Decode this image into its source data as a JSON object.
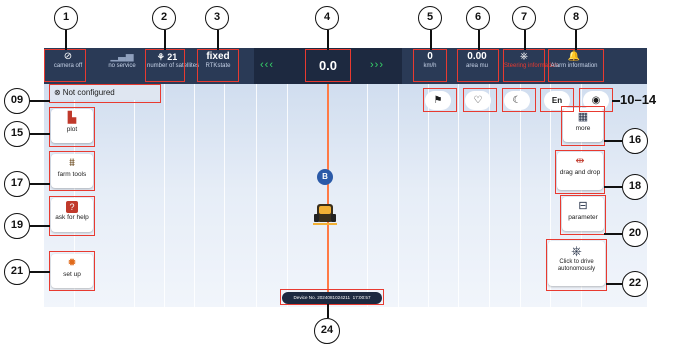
{
  "topbar": {
    "camera": {
      "icon": "camera-off-icon",
      "label": "camera off"
    },
    "network": {
      "icon": "signal-icon",
      "label": "no service"
    },
    "satellites": {
      "icon": "satellite-icon",
      "count": "21",
      "label": "number of satellites"
    },
    "rtk": {
      "status": "fixed",
      "label": "RTKstate"
    },
    "offset": {
      "value": "0.0",
      "left_arrows": "‹‹‹",
      "right_arrows": "›››"
    },
    "speed": {
      "value": "0",
      "unit": "km/h"
    },
    "area": {
      "value": "0.00",
      "label": "area mu"
    },
    "steering": {
      "icon": "steering-wheel-icon",
      "text": "Steering information"
    },
    "alarm": {
      "icon": "bell-icon",
      "label": "Alarm information"
    }
  },
  "status": {
    "not_configured": "Not configured"
  },
  "top_icons": [
    {
      "name": "flag-icon",
      "glyph": "⚑"
    },
    {
      "name": "heart-icon",
      "glyph": "♡"
    },
    {
      "name": "night-mode-icon",
      "glyph": "☾"
    },
    {
      "name": "language-icon",
      "glyph": "En"
    },
    {
      "name": "eye-icon",
      "glyph": "◉"
    }
  ],
  "left_buttons": [
    {
      "label": "plot",
      "icon": "plot-icon"
    },
    {
      "label": "farm tools",
      "icon": "farm-tools-icon"
    },
    {
      "label": "ask for help",
      "icon": "help-icon"
    },
    {
      "label": "set up",
      "icon": "settings-icon"
    }
  ],
  "right_buttons": [
    {
      "label": "more",
      "icon": "more-icon"
    },
    {
      "label": "drag and drop",
      "icon": "drag-drop-icon"
    },
    {
      "label": "parameter",
      "icon": "parameter-icon"
    },
    {
      "label": "Click to drive autonomously",
      "icon": "steering-wheel-icon"
    }
  ],
  "map": {
    "marker": "B",
    "device_no": "Device No. 2024081024211",
    "device_time": "17:00:57"
  },
  "callouts": [
    "1",
    "2",
    "3",
    "4",
    "5",
    "6",
    "7",
    "8",
    "09",
    "10–14",
    "15",
    "16",
    "17",
    "18",
    "19",
    "20",
    "21",
    "22",
    "24"
  ],
  "colors": {
    "topbar": "#2a3a56",
    "field": "#d7e2f0",
    "guide_line": "#ff7a45",
    "highlight": "#e83a30",
    "arrows": "#37d36a"
  }
}
